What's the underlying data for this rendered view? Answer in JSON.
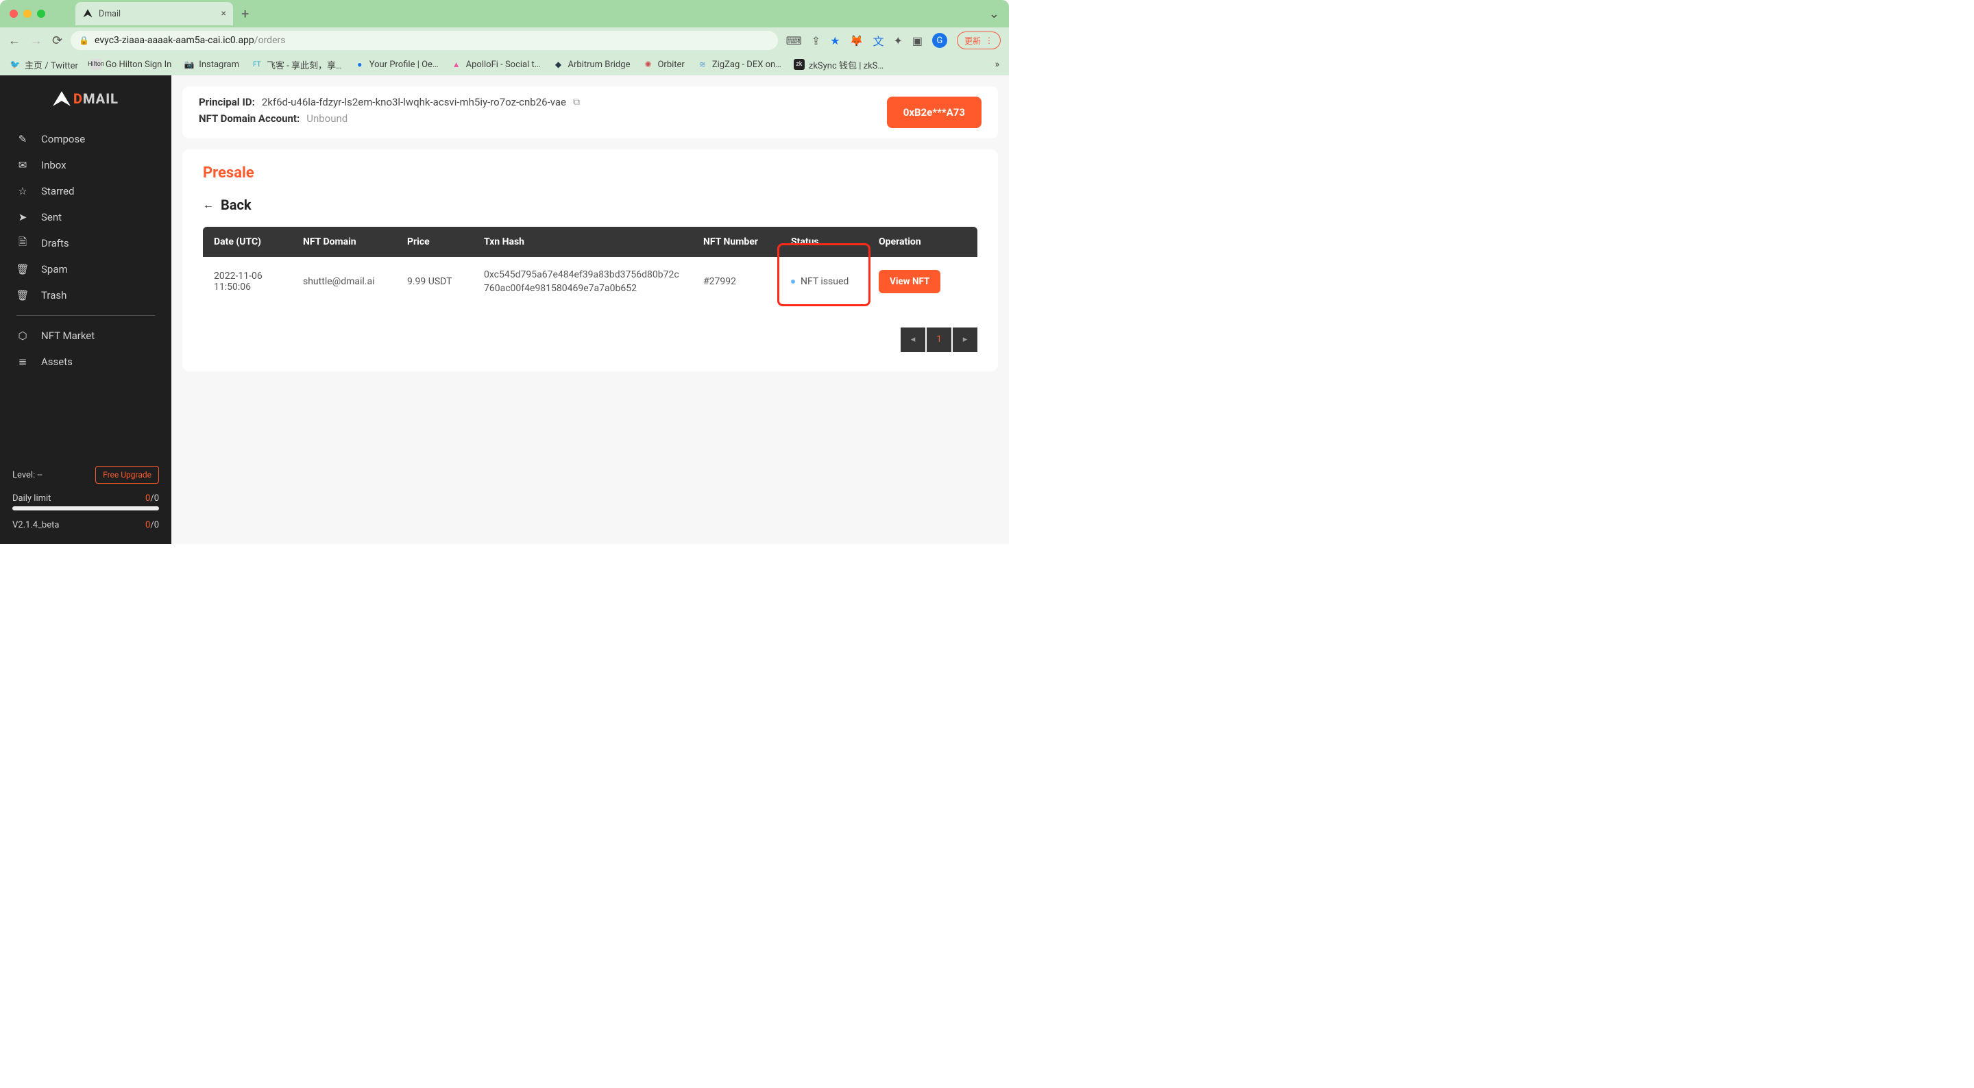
{
  "browser": {
    "tab_title": "Dmail",
    "url_host": "evyc3-ziaaa-aaaak-aam5a-cai.ic0.app",
    "url_path": "/orders",
    "update_label": "更新",
    "avatar_letter": "G"
  },
  "bookmarks": [
    {
      "label": "主页 / Twitter"
    },
    {
      "label": "Go Hilton Sign In"
    },
    {
      "label": "Instagram"
    },
    {
      "label": "飞客 - 享此刻，享…"
    },
    {
      "label": "Your Profile | Oe…"
    },
    {
      "label": "ApolloFi - Social t…"
    },
    {
      "label": "Arbitrum Bridge"
    },
    {
      "label": "Orbiter"
    },
    {
      "label": "ZigZag - DEX on…"
    },
    {
      "label": "zkSync 钱包 | zkS…"
    }
  ],
  "sidebar": {
    "logo_text_d": "D",
    "logo_text_rest": "MAIL",
    "items": [
      {
        "icon": "compose-icon",
        "label": "Compose"
      },
      {
        "icon": "inbox-icon",
        "label": "Inbox"
      },
      {
        "icon": "star-icon",
        "label": "Starred"
      },
      {
        "icon": "sent-icon",
        "label": "Sent"
      },
      {
        "icon": "drafts-icon",
        "label": "Drafts"
      },
      {
        "icon": "spam-icon",
        "label": "Spam"
      },
      {
        "icon": "trash-icon",
        "label": "Trash"
      }
    ],
    "items2": [
      {
        "icon": "nft-icon",
        "label": "NFT Market"
      },
      {
        "icon": "assets-icon",
        "label": "Assets"
      }
    ],
    "level_label": "Level:",
    "level_value": "--",
    "free_upgrade": "Free Upgrade",
    "daily_limit_label": "Daily limit",
    "daily_limit_used": "0",
    "daily_limit_total": "/0",
    "version": "V2.1.4_beta",
    "version_used": "0",
    "version_total": "/0"
  },
  "header": {
    "principal_label": "Principal ID:",
    "principal_value": "2kf6d-u46la-fdzyr-ls2em-kno3l-lwqhk-acsvi-mh5iy-ro7oz-cnb26-vae",
    "nft_account_label": "NFT Domain Account:",
    "nft_account_value": "Unbound",
    "wallet": "0xB2e***A73"
  },
  "content": {
    "presale_title": "Presale",
    "back_label": "Back",
    "columns": {
      "date": "Date (UTC)",
      "domain": "NFT Domain",
      "price": "Price",
      "hash": "Txn Hash",
      "number": "NFT Number",
      "status": "Status",
      "operation": "Operation"
    },
    "rows": [
      {
        "date": "2022-11-06 11:50:06",
        "domain": "shuttle@dmail.ai",
        "price": "9.99 USDT",
        "hash": "0xc545d795a67e484ef39a83bd3756d80b72c760ac00f4e981580469e7a7a0b652",
        "number": "#27992",
        "status": "NFT issued",
        "operation": "View NFT"
      }
    ],
    "pagination": {
      "current": "1"
    }
  }
}
